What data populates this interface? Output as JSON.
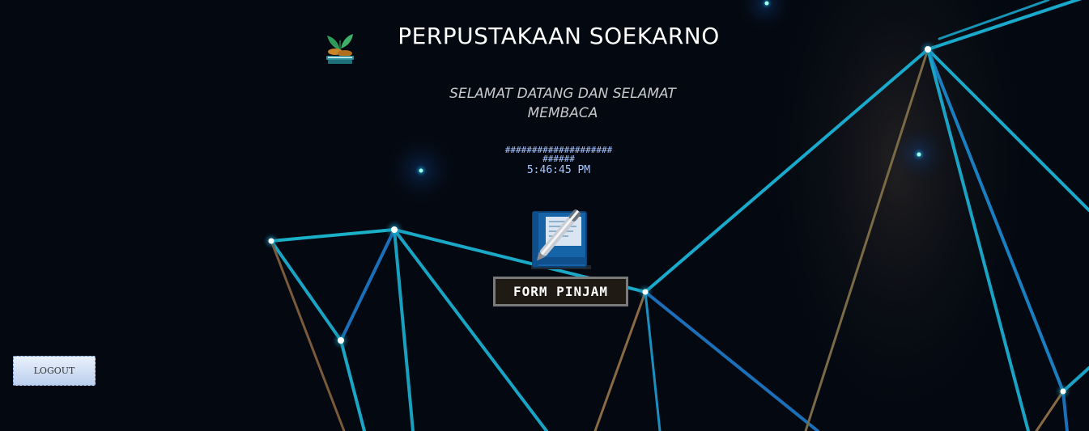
{
  "header": {
    "logo_icon": "book-leaf-logo-icon",
    "title": "PERPUSTAKAAN SOEKARNO"
  },
  "welcome": {
    "line1": "SELAMAT DATANG DAN SELAMAT",
    "line2": "MEMBACA"
  },
  "clock": {
    "mask_line1": "####################",
    "mask_line2": "######",
    "time": "5:46:45 PM"
  },
  "form_pinjam": {
    "icon": "book-pen-icon",
    "label": "FORM PINJAM"
  },
  "logout": {
    "label": "LOGOUT"
  },
  "colors": {
    "background": "#050a12",
    "network_line": "#1fb0cc",
    "button_dark": "#1f1b14",
    "clock_text": "#a9c8ff"
  }
}
